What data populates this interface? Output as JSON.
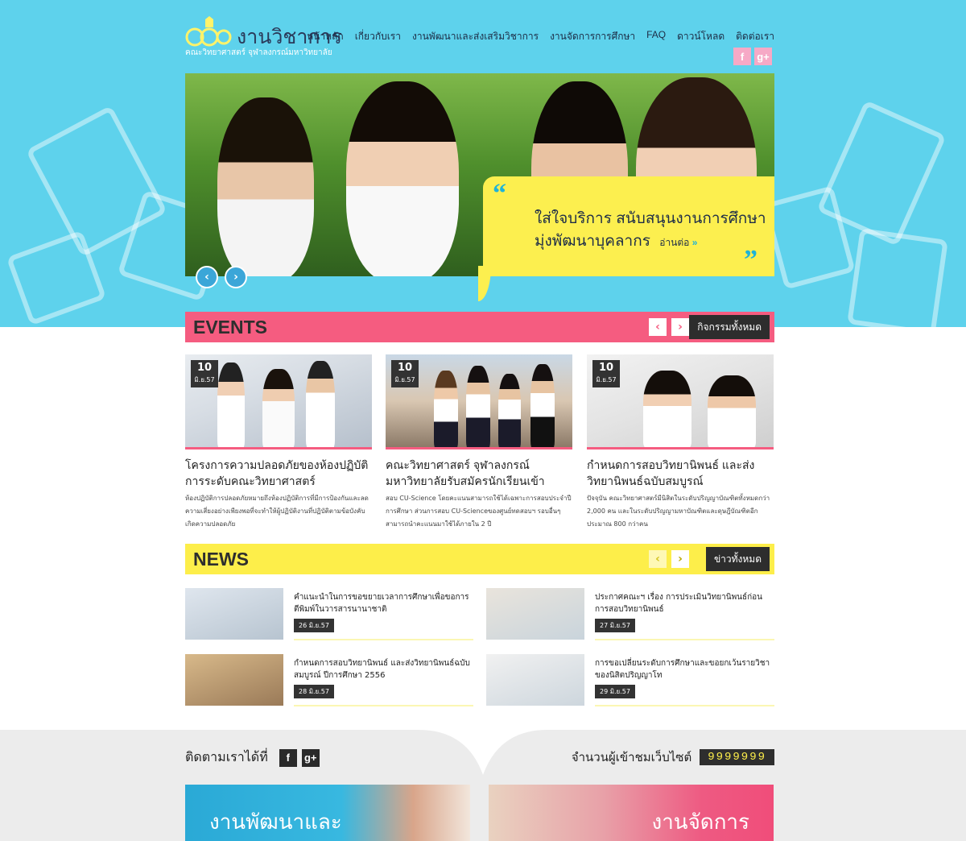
{
  "colors": {
    "hero_bg": "#5ed2ec",
    "events_bar": "#f55c80",
    "news_bar": "#fdee4a",
    "quote_bg": "#fcef4f",
    "dark_button": "#2d2d2d",
    "footer_bg": "#ececec"
  },
  "header": {
    "logo_title": "งานวิชาการ",
    "logo_subtitle": "คณะวิทยาศาสตร์ จุฬาลงกรณ์มหาวิทยาลัย",
    "nav": [
      "หน้าหลัก",
      "เกี่ยวกับเรา",
      "งานพัฒนาและส่งเสริมวิชาการ",
      "งานจัดการการศึกษา",
      "FAQ",
      "ดาวน์โหลด",
      "ติดต่อเรา"
    ],
    "social": [
      "facebook-icon",
      "google-plus-icon"
    ]
  },
  "hero": {
    "quote_line1": "ใส่ใจบริการ สนับสนุนงานการศึกษา",
    "quote_line2": "มุ่งพัฒนาบุคลากร",
    "read_more": "อ่านต่อ"
  },
  "events": {
    "title": "EVENTS",
    "all_label": "กิจกรรมทั้งหมด",
    "items": [
      {
        "day": "10",
        "month": "มิ.ย.57",
        "title": "โครงการความปลอดภัยของห้องปฏิบัติการระดับคณะวิทยาศาสตร์",
        "text": "ห้องปฏิบัติการปลอดภัยหมายถึงห้องปฏิบัติการที่มีการป้องกันและลดความเสี่ยงอย่างเพียงพอที่จะทำให้ผู้ปฏิบัติงานที่ปฏิบัติตามข้อบังคับเกิดความปลอดภัย"
      },
      {
        "day": "10",
        "month": "มิ.ย.57",
        "title": "คณะวิทยาศาสตร์ จุฬาลงกรณ์มหาวิทยาลัยรับสมัครนักเรียนเข้าศึกษา โดยวิธีรับตรง",
        "text": "สอบ CU-Science โดยคะแนนสามารถใช้ได้เฉพาะการสอบประจำปีการศึกษา ส่วนการสอบ CU-Scienceของศูนย์ทดสอบฯ รอบอื่นๆ สามารถนำคะแนนมาใช้ได้ภายใน 2 ปี"
      },
      {
        "day": "10",
        "month": "มิ.ย.57",
        "title": "กำหนดการสอบวิทยานิพนธ์ และส่งวิทยานิพนธ์ฉบับสมบูรณ์",
        "text": "ปัจจุบัน คณะวิทยาศาสตร์มีนิสิตในระดับปริญญาบัณฑิตทั้งหมดกว่า 2,000 คน และในระดับปริญญามหาบัณฑิตและดุษฎีบัณฑิตอีกประมาณ 800 กว่าคน"
      }
    ]
  },
  "news": {
    "title": "NEWS",
    "all_label": "ข่าวทั้งหมด",
    "items": [
      {
        "title": "คำแนะนำในการขอขยายเวลาการศึกษาเพื่อขอการตีพิมพ์ในวารสารนานาชาติ",
        "date": "26 มิ.ย.57"
      },
      {
        "title": "ประกาศคณะฯ เรื่อง การประเมินวิทยานิพนธ์ก่อนการสอบวิทยานิพนธ์",
        "date": "27 มิ.ย.57"
      },
      {
        "title": "กำหนดการสอบวิทยานิพนธ์ และส่งวิทยานิพนธ์ฉบับสมบูรณ์ ปีการศึกษา 2556",
        "date": "28 มิ.ย.57"
      },
      {
        "title": "การขอเปลี่ยนระดับการศึกษาและขอยกเว้นรายวิชาของนิสิตปริญญาโท",
        "date": "29 มิ.ย.57"
      }
    ]
  },
  "footer": {
    "follow_label": "ติดตามเราได้ที่",
    "visitors_label": "จำนวนผู้เข้าชมเว็บไซต์",
    "visitor_count": "9999999",
    "promo_left": "งานพัฒนาและ",
    "promo_right": "งานจัดการ"
  }
}
